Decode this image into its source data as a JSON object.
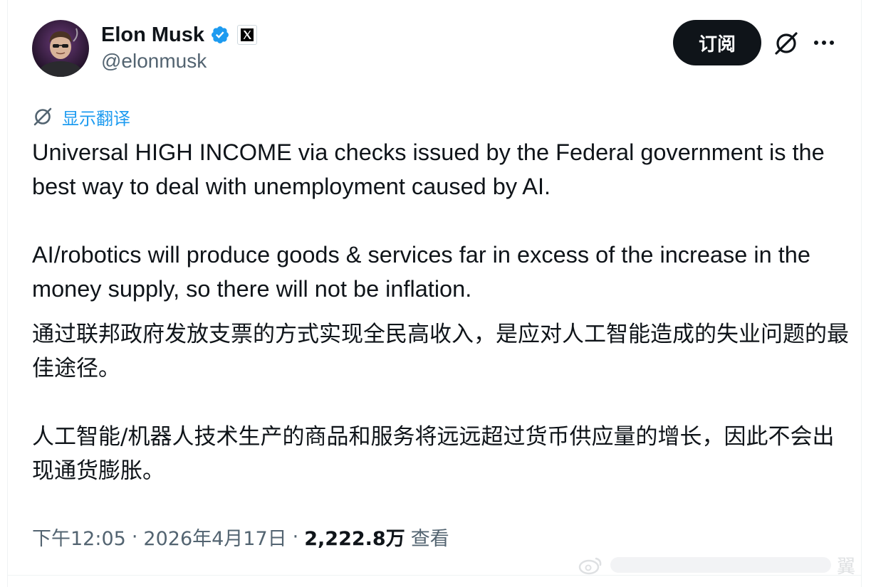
{
  "author": {
    "display_name": "Elon Musk",
    "handle": "@elonmusk",
    "verified_icon": "verified-badge-icon",
    "affiliate_icon": "x-logo-icon"
  },
  "actions": {
    "subscribe_label": "订阅",
    "grok_icon": "grok-icon",
    "more_icon": "more-horizontal-icon"
  },
  "translate": {
    "label": "显示翻译",
    "icon": "grok-icon"
  },
  "tweet": {
    "en_paragraphs": [
      "Universal HIGH INCOME via checks issued by the Federal government is the best way to deal with unemployment caused by AI.",
      "AI/robotics will produce goods & services far in excess of the increase in the money supply, so there will not be inflation."
    ],
    "zh_paragraphs": [
      "通过联邦政府发放支票的方式实现全民高收入，是应对人工智能造成的失业问题的最佳途径。",
      "人工智能/机器人技术生产的商品和服务将远远超过货币供应量的增长，因此不会出现通货膨胀。"
    ]
  },
  "meta": {
    "time": "下午12:05",
    "separator": "·",
    "date": "2026年4月17日",
    "views_count": "2,222.8万",
    "views_label": "查看"
  },
  "watermark": {
    "text": "翼"
  },
  "colors": {
    "accent": "#1d9bf0",
    "text_primary": "#0f1419",
    "text_secondary": "#536471"
  }
}
